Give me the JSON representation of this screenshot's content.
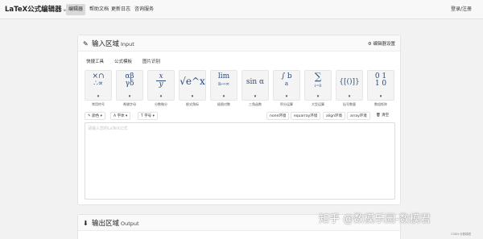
{
  "navbar": {
    "brand": "LaTeX公式编辑器",
    "version": "ver1.72",
    "items": [
      {
        "label": "编辑器",
        "active": true
      },
      {
        "label": "帮助文档",
        "active": false
      },
      {
        "label": "更新日志",
        "active": false
      },
      {
        "label": "咨询服务",
        "active": false
      }
    ],
    "login": "登录/注册"
  },
  "input_panel": {
    "icon": "edit-icon",
    "title": "输入区域",
    "title_en": "Input",
    "settings_icon": "gear-icon",
    "settings_label": "编辑器设置",
    "tabs": [
      "快捷工具",
      "公式模板",
      "图片识别"
    ],
    "symbols": [
      {
        "glyph_top": "×∩",
        "glyph_bottom": "∴∝",
        "label": "常用符号"
      },
      {
        "glyph_top": "αβ",
        "glyph_bottom": "γδ",
        "label": "希腊字母"
      },
      {
        "glyph_top": "x",
        "glyph_bottom": "y",
        "label": "分数微分"
      },
      {
        "glyph_top": "√e^x",
        "glyph_bottom": "",
        "label": "根式角标"
      },
      {
        "glyph_top": "lim",
        "glyph_bottom": "n→∞",
        "label": "极限对数"
      },
      {
        "glyph_top": "sin α",
        "glyph_bottom": "",
        "label": "三角函数"
      },
      {
        "glyph_top": "∫ b",
        "glyph_bottom": "a",
        "label": "积分运算"
      },
      {
        "glyph_top": "∑",
        "glyph_bottom": "i=0",
        "label": "大型运算"
      },
      {
        "glyph_top": "{[()]}",
        "glyph_bottom": "",
        "label": "括号数量"
      },
      {
        "glyph_top": "0 1",
        "glyph_bottom": "1 0",
        "label": "数组矩阵"
      }
    ],
    "toolbar": {
      "color": "颜色",
      "font": "字体",
      "size": "字号",
      "envs": [
        "none环境",
        "equarray环境",
        "align环境",
        "array环境"
      ],
      "clear": "清空"
    },
    "editor_placeholder": "请输入您的LaTeX公式"
  },
  "output_panel": {
    "icon": "download-icon",
    "title": "输出区域",
    "title_en": "Output"
  },
  "watermark": "知乎 @数模乐园-数模君",
  "watermark_small": "CSDN @数模君"
}
